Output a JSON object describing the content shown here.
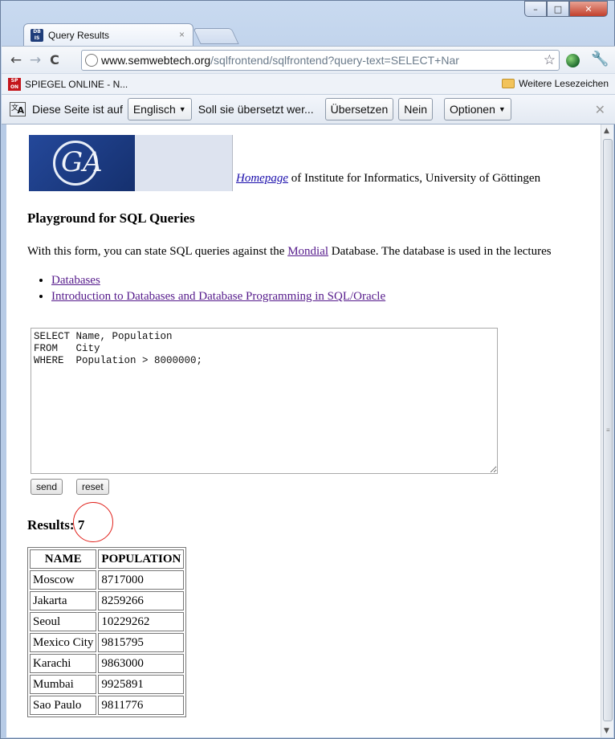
{
  "window": {
    "minimize": "–",
    "maximize": "□",
    "close": "✕"
  },
  "tab": {
    "favicon_text": "DB IS",
    "title": "Query Results",
    "close": "×"
  },
  "toolbar": {
    "back": "←",
    "forward": "→",
    "reload": "C",
    "url_host": "www.semwebtech.org",
    "url_path": "/sqlfrontend/sqlfrontend?query-text=SELECT+Nar",
    "star": "☆",
    "wrench": "🔧"
  },
  "bookmarks": {
    "spiegel_icon": "SP ON",
    "spiegel_label": "SPIEGEL ONLINE - N...",
    "other_label": "Weitere Lesezeichen"
  },
  "translate_bar": {
    "text_prefix": "Diese Seite ist auf",
    "language": "Englisch",
    "text_suffix": "Soll sie übersetzt wer...",
    "translate_button": "Übersetzen",
    "no_button": "Nein",
    "options_button": "Optionen",
    "close": "✕"
  },
  "page": {
    "homepage_link": "Homepage",
    "homepage_suffix": " of Institute for Informatics, University of Göttingen",
    "heading": "Playground for SQL Queries",
    "intro_prefix": "With this form, you can state SQL queries against the ",
    "intro_link": "Mondial",
    "intro_suffix": " Database. The database is used in the lectures",
    "links": [
      "Databases",
      "Introduction to Databases and Database Programming in SQL/Oracle"
    ],
    "query": "SELECT Name, Population\nFROM   City\nWHERE  Population > 8000000;",
    "send_button": "send",
    "reset_button": "reset",
    "results_label": "Results",
    "results_count": ": 7"
  },
  "results_table": {
    "headers": [
      "NAME",
      "POPULATION"
    ],
    "rows": [
      [
        "Moscow",
        "8717000"
      ],
      [
        "Jakarta",
        "8259266"
      ],
      [
        "Seoul",
        "10229262"
      ],
      [
        "Mexico City",
        "9815795"
      ],
      [
        "Karachi",
        "9863000"
      ],
      [
        "Mumbai",
        "9925891"
      ],
      [
        "Sao Paulo",
        "9811776"
      ]
    ]
  },
  "colors": {
    "link": "#1a0dab",
    "visited_link": "#551a8b",
    "annotation_circle": "#e0201a"
  }
}
